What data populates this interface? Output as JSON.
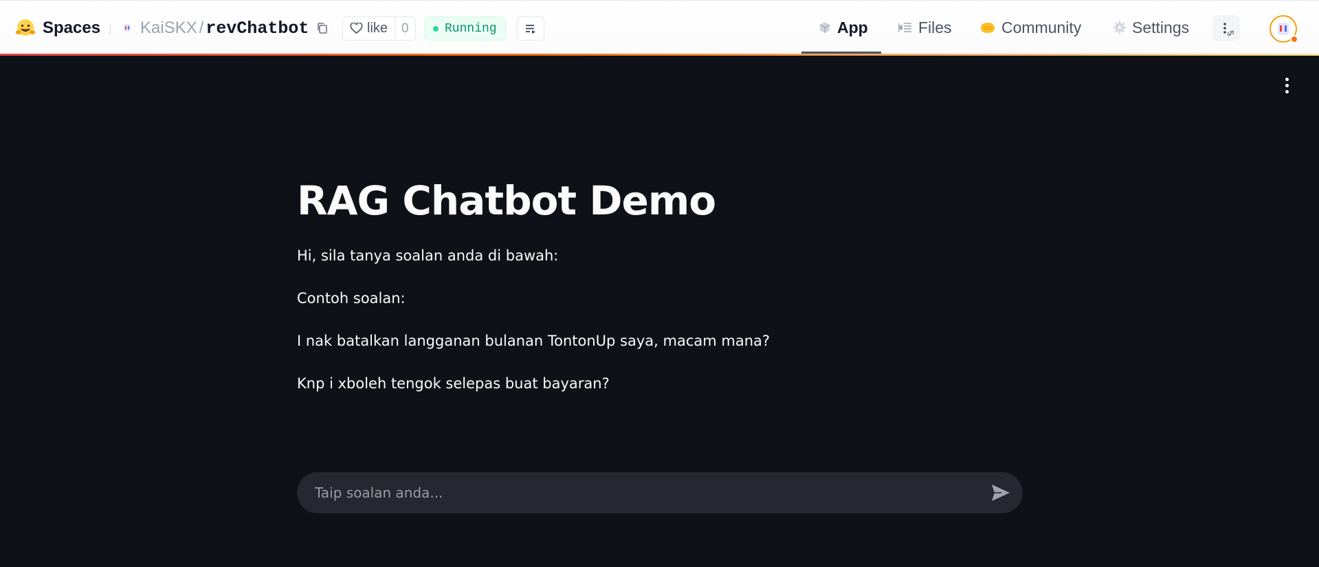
{
  "header": {
    "brand_name": "Spaces",
    "repo_owner": "KaiSKX",
    "repo_slash": "/",
    "repo_name": "revChatbot",
    "like_label": "like",
    "like_count": "0",
    "status": "Running",
    "tabs": [
      {
        "label": "App",
        "icon": "cube-icon",
        "active": true
      },
      {
        "label": "Files",
        "icon": "files-icon",
        "active": false
      },
      {
        "label": "Community",
        "icon": "community-icon",
        "active": false
      },
      {
        "label": "Settings",
        "icon": "gear-icon",
        "active": false
      }
    ],
    "colors": {
      "accent_start": "#e5484d",
      "accent_end": "#fde68a",
      "status_green": "#059669"
    }
  },
  "app": {
    "title": "RAG Chatbot Demo",
    "paragraphs": [
      "Hi, sila tanya soalan anda di bawah:",
      "Contoh soalan:",
      "I nak batalkan langganan bulanan TontonUp saya, macam mana?",
      "Knp i xboleh tengok selepas buat bayaran?"
    ],
    "chat_input": {
      "value": "",
      "placeholder": "Taip soalan anda..."
    },
    "colors": {
      "background": "#0e1117",
      "input_bg": "#262730",
      "text": "#fafafa"
    }
  }
}
